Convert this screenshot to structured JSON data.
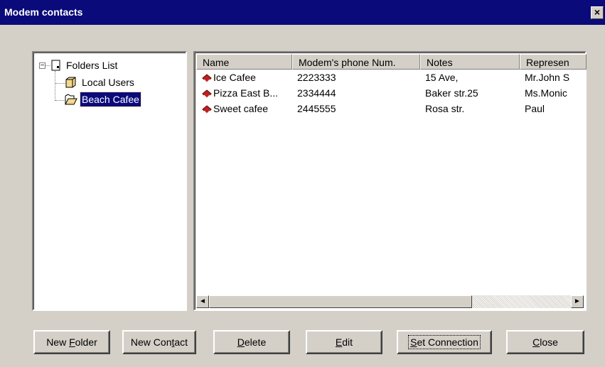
{
  "window": {
    "title": "Modem contacts",
    "close_glyph": "×"
  },
  "tree": {
    "root": {
      "label": "Folders List",
      "expander": "−",
      "icon": "computer-icon"
    },
    "items": [
      {
        "label": "Local Users",
        "icon": "folder-icon",
        "selected": false
      },
      {
        "label": "Beach Cafee",
        "icon": "open-folder-icon",
        "selected": true
      }
    ]
  },
  "list": {
    "columns": [
      "Name",
      "Modem's phone Num.",
      "Notes",
      "Represen"
    ],
    "rows": [
      {
        "icon": "contact-icon",
        "name": "Ice Cafee",
        "phone": "2223333",
        "notes": "15 Ave,",
        "rep": "Mr.John S"
      },
      {
        "icon": "contact-icon",
        "name": "Pizza East B...",
        "phone": "2334444",
        "notes": "Baker str.25",
        "rep": "Ms.Monic"
      },
      {
        "icon": "contact-icon",
        "name": "Sweet cafee",
        "phone": "2445555",
        "notes": "Rosa str.",
        "rep": "Paul"
      }
    ],
    "scroll_left": "◄",
    "scroll_right": "►"
  },
  "buttons": {
    "new_folder": {
      "pre": "New ",
      "key": "F",
      "post": "older"
    },
    "new_contact": {
      "pre": "New Con",
      "key": "t",
      "post": "act"
    },
    "delete": {
      "pre": "",
      "key": "D",
      "post": "elete"
    },
    "edit": {
      "pre": "",
      "key": "E",
      "post": "dit"
    },
    "set_connection": {
      "pre": "",
      "key": "S",
      "post": "et Connection"
    },
    "close": {
      "pre": "",
      "key": "C",
      "post": "lose"
    }
  }
}
